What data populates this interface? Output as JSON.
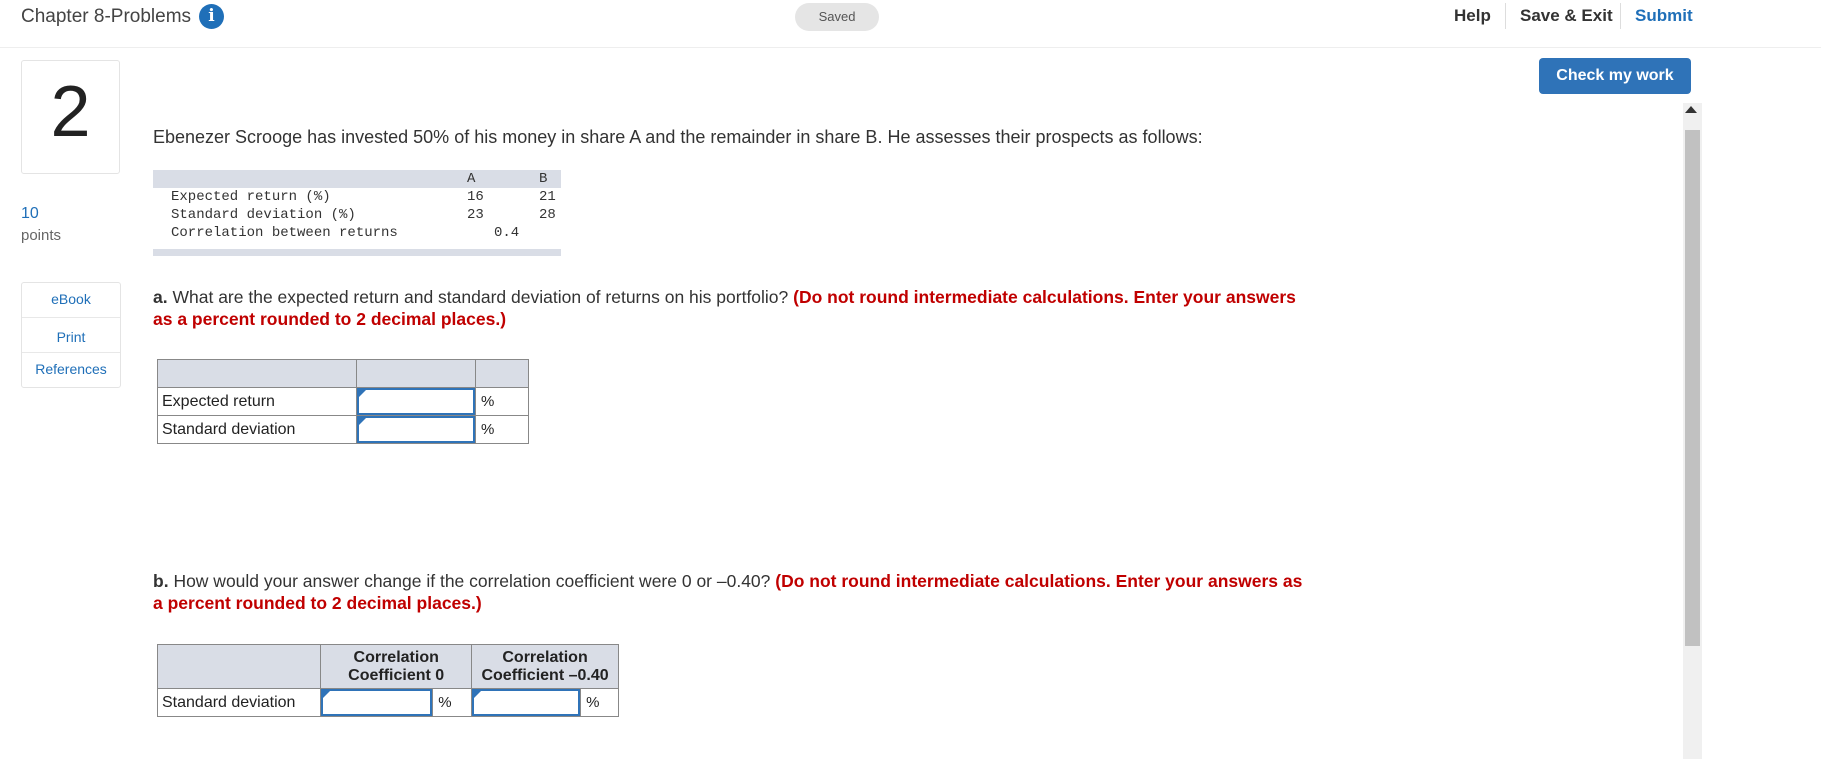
{
  "header": {
    "chapter_title": "Chapter 8-Problems",
    "info_icon": "info-icon",
    "saved": "Saved",
    "help": "Help",
    "save_exit": "Save & Exit",
    "submit": "Submit",
    "check_my_work": "Check my work"
  },
  "question": {
    "number": "2",
    "points_value": "10",
    "points_label": "points",
    "resources": [
      "eBook",
      "Print",
      "References"
    ],
    "intro": "Ebenezer Scrooge has invested 50% of his money in share A and the remainder in share B. He assesses their prospects as follows:"
  },
  "data_table": {
    "col_a": "A",
    "col_b": "B",
    "rows": [
      {
        "label": "Expected return (%)",
        "a": "16",
        "b": "21"
      },
      {
        "label": "Standard deviation (%)",
        "a": "23",
        "b": "28"
      },
      {
        "label": "Correlation between returns",
        "mid": "0.4"
      }
    ]
  },
  "part_a": {
    "prefix": "a.",
    "text": "What are the expected return and standard deviation of returns on his portfolio?",
    "instruction": "(Do not round intermediate calculations. Enter your answers as a percent rounded to 2 decimal places.)",
    "rows": [
      {
        "label": "Expected return",
        "value": "",
        "unit": "%"
      },
      {
        "label": "Standard deviation",
        "value": "",
        "unit": "%"
      }
    ]
  },
  "part_b": {
    "prefix": "b.",
    "text": "How would your answer change if the correlation coefficient were 0 or –0.40?",
    "instruction": "(Do not round intermediate calculations. Enter your answers as a percent rounded to 2 decimal places.)",
    "col1_line1": "Correlation",
    "col1_line2": "Coefficient 0",
    "col2_line1": "Correlation",
    "col2_line2": "Coefficient –0.40",
    "row_label": "Standard deviation",
    "unit": "%",
    "value1": "",
    "value2": ""
  },
  "colors": {
    "accent": "#2f73b8",
    "instruction_red": "#c00000",
    "table_header": "#d9dde6"
  }
}
